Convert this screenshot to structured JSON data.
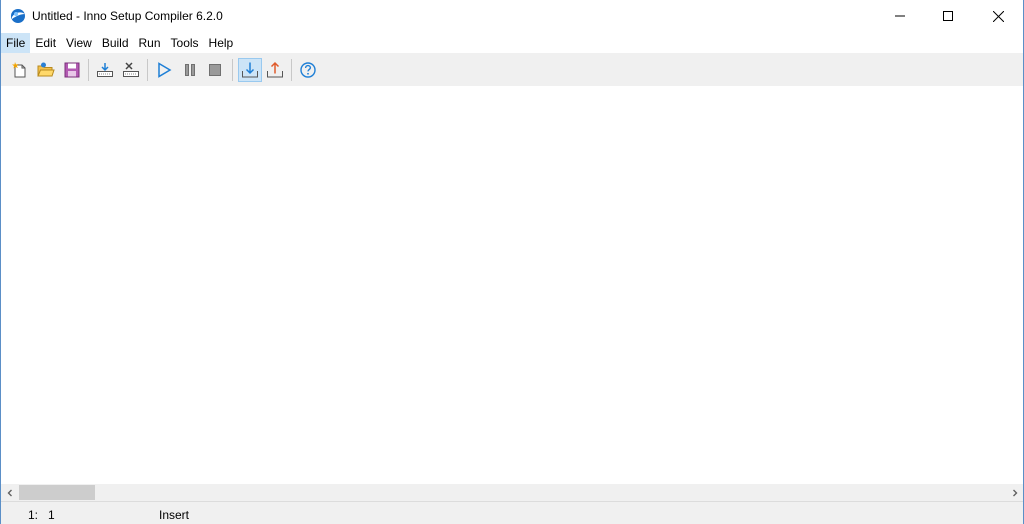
{
  "window": {
    "title": "Untitled - Inno Setup Compiler 6.2.0"
  },
  "menu": [
    {
      "label": "File"
    },
    {
      "label": "Edit"
    },
    {
      "label": "View"
    },
    {
      "label": "Build"
    },
    {
      "label": "Run"
    },
    {
      "label": "Tools"
    },
    {
      "label": "Help"
    }
  ],
  "toolbar": {
    "buttons": [
      "new-icon",
      "open-icon",
      "save-icon",
      "compile-icon",
      "stop-compile-icon",
      "run-icon",
      "pause-icon",
      "terminate-icon",
      "target-setup-icon",
      "target-uninstall-icon",
      "help-icon"
    ]
  },
  "status": {
    "position": "1:   1",
    "mode": "Insert"
  },
  "colors": {
    "menu_highlight": "#cce4f7",
    "accent_blue": "#1e7fd6",
    "toolbar_bg": "#f0f0f0"
  }
}
